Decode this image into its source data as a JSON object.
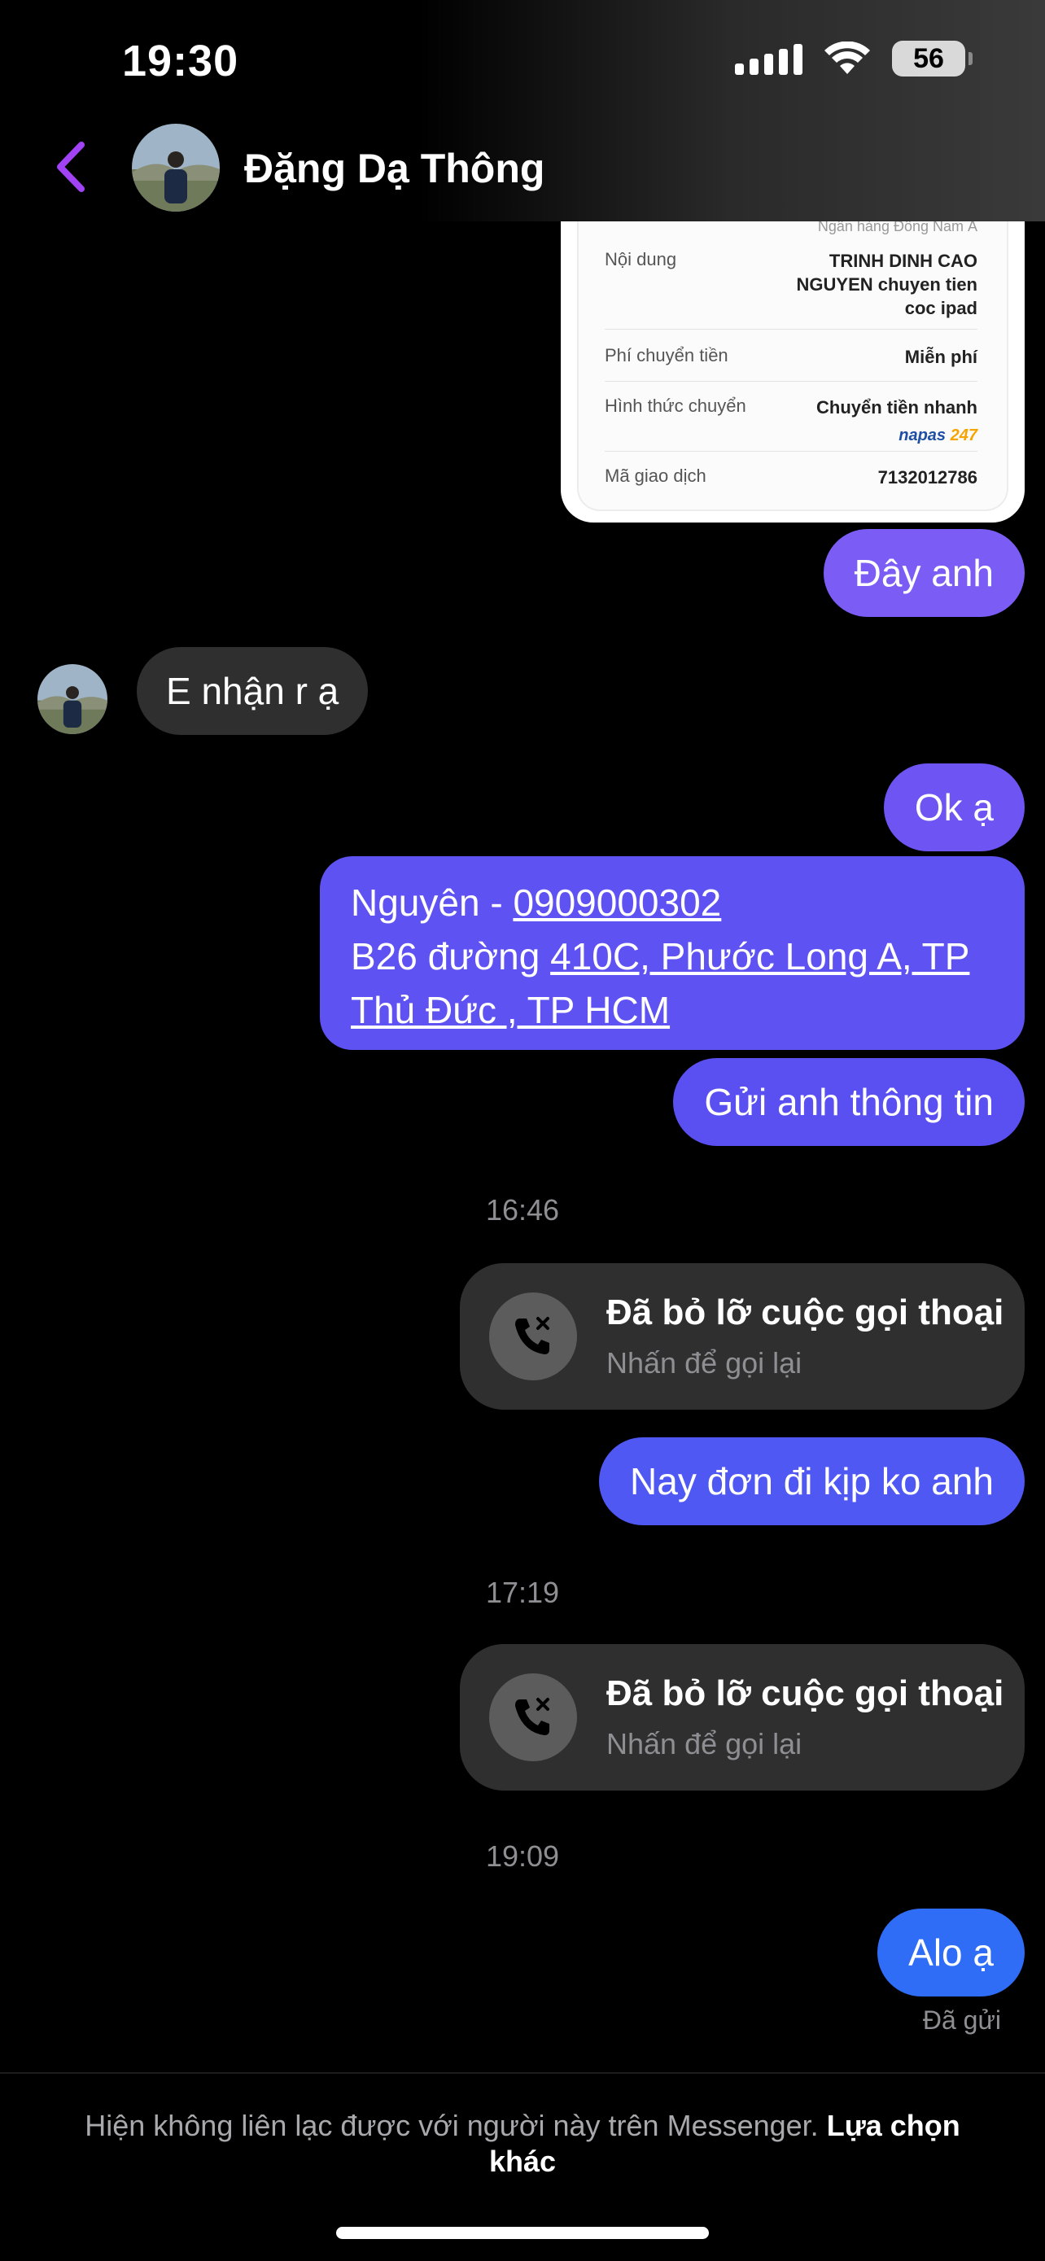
{
  "status_bar": {
    "time": "19:30",
    "battery": "56"
  },
  "header": {
    "contact_name": "Đặng Dạ Thông"
  },
  "receipt": {
    "bank_partial": "Ngân hàng Đông Nam Á",
    "rows": [
      {
        "label": "Nội dung",
        "value_lines": [
          "TRINH DINH CAO",
          "NGUYEN chuyen tien",
          "coc ipad"
        ]
      },
      {
        "label": "Phí chuyển tiền",
        "value_lines": [
          "Miễn phí"
        ]
      },
      {
        "label": "Hình thức chuyển",
        "value_lines": [
          "Chuyển tiền nhanh"
        ]
      },
      {
        "label": "Mã giao dịch",
        "value_lines": [
          "7132012786"
        ]
      }
    ],
    "napas_brand": "napas",
    "napas_num": "247"
  },
  "messages": {
    "m1": "Đây anh",
    "m2": "E nhận r ạ",
    "m3": "Ok ạ",
    "m4": {
      "line1_prefix": "Nguyên - ",
      "line1_link": "0909000302",
      "line2_prefix": "B26 đường ",
      "line2_link": "410C, Phước Long A, TP",
      "line3_link": "Thủ Đức , TP HCM"
    },
    "m5": "Gửi anh thông tin",
    "m6": "Nay đơn đi kịp ko anh",
    "m7": "Alo ạ"
  },
  "timestamps": {
    "t1": "16:46",
    "t2": "17:19",
    "t3": "19:09"
  },
  "calls": {
    "title": "Đã bỏ lỡ cuộc gọi thoại",
    "subtitle": "Nhấn để gọi lại"
  },
  "delivery_status": "Đã gửi",
  "footer": {
    "note": "Hiện không liên lạc được với người này trên Messenger.",
    "action": "Lựa chọn khác"
  },
  "colors": {
    "outgoing_purple": "#7b5cf5",
    "outgoing_indigo": "#5b4ff0",
    "outgoing_blue": "#2f6df6",
    "incoming": "#2f2f2f",
    "accent_back": "#a142f4"
  },
  "icons": [
    "chevron-left-icon",
    "phone-missed-icon",
    "signal-icon",
    "wifi-icon",
    "battery-icon"
  ]
}
